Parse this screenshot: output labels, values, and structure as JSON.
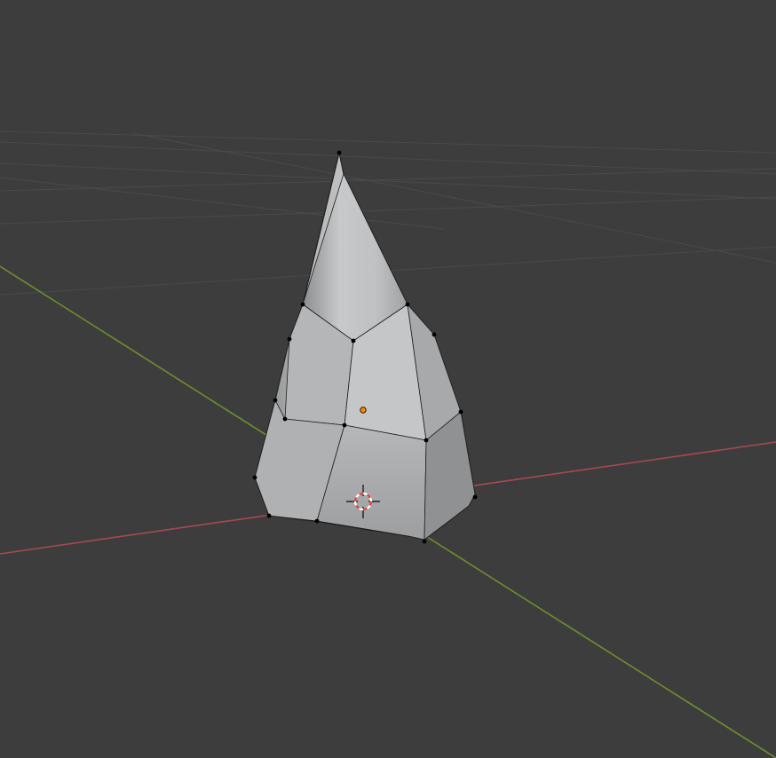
{
  "editor": {
    "type": "3D Viewport",
    "mode": "Edit Mode",
    "object_shape": "cone",
    "visible_text": []
  },
  "colors": {
    "background": "#3d3d3d",
    "grid_line": "#4a4a4a",
    "x_axis": "#a54a55",
    "y_axis": "#6e8d2f",
    "mesh_face_light": "#c6c8c9",
    "mesh_face_mid": "#a3a5a7",
    "mesh_face_dark": "#7e8082",
    "mesh_edge": "#1e1e1e",
    "vertex": "#000000",
    "origin_dot": "#ff8a00",
    "cursor_ring_red": "#e23a3a",
    "cursor_ring_white": "#ffffff"
  },
  "icons": {
    "origin": "object-origin-icon",
    "cursor": "3d-cursor-icon"
  }
}
